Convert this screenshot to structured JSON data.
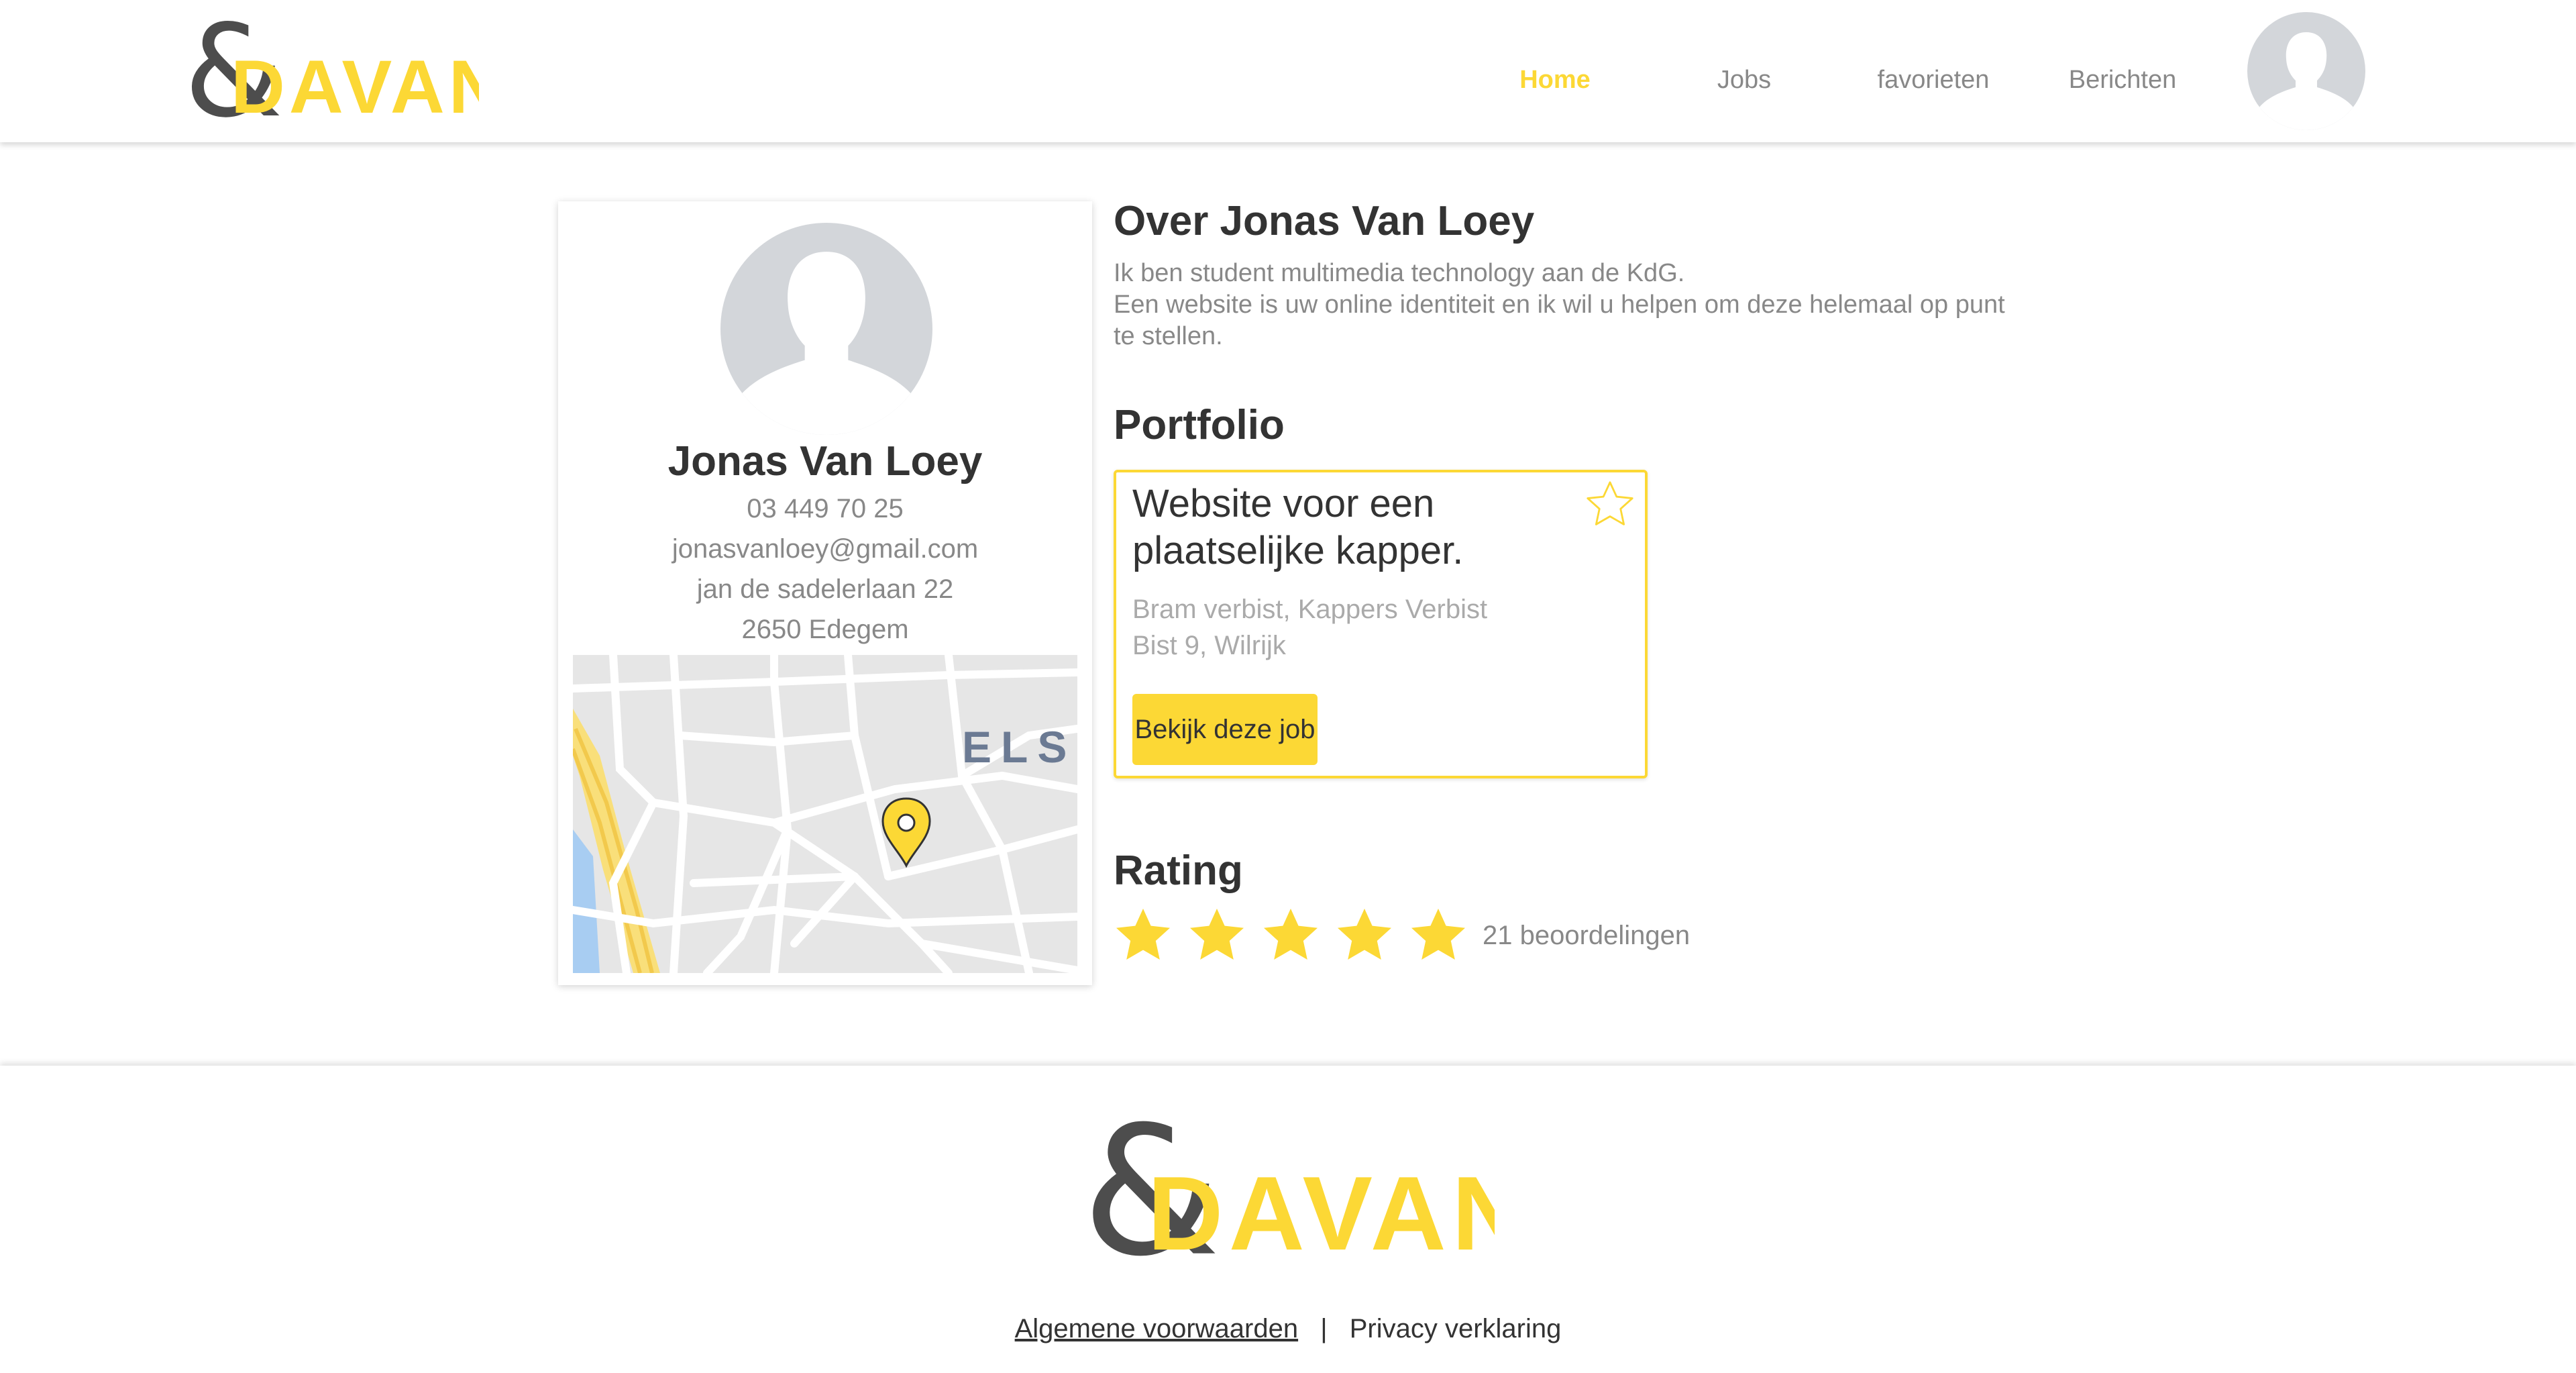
{
  "header": {
    "logo": {
      "symbol": "&",
      "text": "DAVANT"
    },
    "nav": [
      {
        "label": "Home",
        "active": true
      },
      {
        "label": "Jobs",
        "active": false
      },
      {
        "label": "favorieten",
        "active": false
      },
      {
        "label": "Berichten",
        "active": false
      }
    ],
    "avatar_icon": "user-silhouette-icon"
  },
  "profile": {
    "name": "Jonas Van Loey",
    "phone": "03 449 70 25",
    "email": "jonasvanloey@gmail.com",
    "street": "jan de sadelerlaan 22",
    "city": "2650 Edegem",
    "map": {
      "label": "ELS",
      "marker_icon": "map-pin-icon"
    }
  },
  "about": {
    "title": "Over Jonas Van Loey",
    "text_line1": "Ik ben student multimedia technology aan de KdG.",
    "text_line2": "Een website is uw online identiteit en ik wil u helpen om deze helemaal op punt te stellen."
  },
  "portfolio": {
    "title": "Portfolio",
    "job": {
      "title": "Website voor een plaatselijke kapper.",
      "client": "Bram verbist, Kappers Verbist",
      "address": "Bist 9, Wilrijk",
      "button_label": "Bekijk deze job",
      "favorite_icon": "star-outline-icon"
    }
  },
  "rating": {
    "title": "Rating",
    "stars": 5,
    "max_stars": 5,
    "count_label": "21 beoordelingen"
  },
  "footer": {
    "logo": {
      "symbol": "&",
      "text": "DAVANT"
    },
    "terms_label": "Algemene voorwaarden",
    "separator": "|",
    "privacy_label": "Privacy verklaring"
  },
  "colors": {
    "accent": "#fcd835",
    "text_dark": "#333333",
    "text_muted": "#888888",
    "avatar_bg": "#d3d6da"
  }
}
